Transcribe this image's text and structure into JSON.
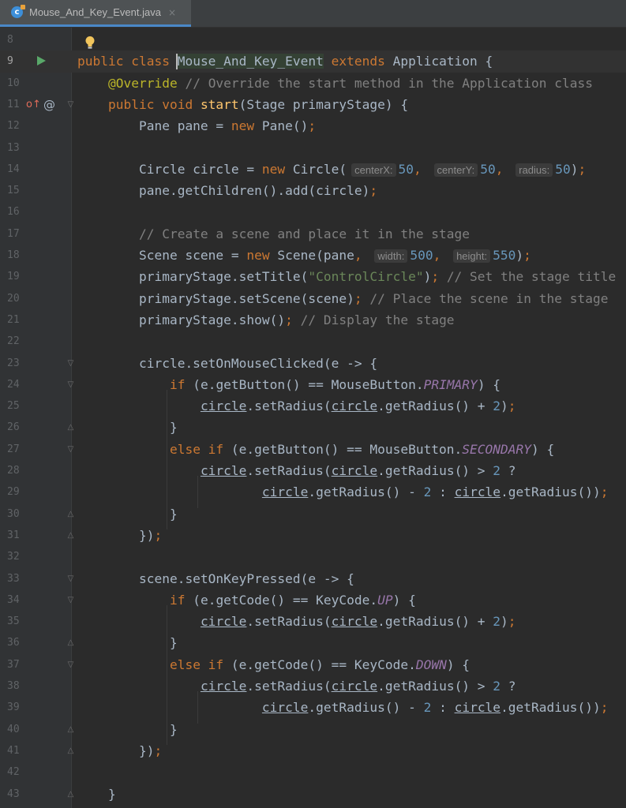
{
  "tab": {
    "icon": "java-class-icon",
    "icon_letter": "c",
    "title": "Mouse_And_Key_Event.java",
    "close": "×"
  },
  "lines": [
    {
      "n": "8",
      "code": []
    },
    {
      "n": "9",
      "code": [
        [
          "kw",
          "public class "
        ],
        [
          "",
          "Mouse_And_Key_Event "
        ],
        [
          "kw",
          "extends "
        ],
        [
          "",
          "Application {"
        ]
      ]
    },
    {
      "n": "10",
      "code": [
        [
          "",
          "    "
        ],
        [
          "an",
          "@Override "
        ],
        [
          "cm",
          "// Override the start method in the Application class"
        ]
      ]
    },
    {
      "n": "11",
      "code": [
        [
          "",
          "    "
        ],
        [
          "kw",
          "public void "
        ],
        [
          "fn",
          "start"
        ],
        [
          "",
          "(Stage primaryStage) {"
        ]
      ]
    },
    {
      "n": "12",
      "code": [
        [
          "",
          "        Pane pane = "
        ],
        [
          "kw",
          "new "
        ],
        [
          "",
          "Pane()"
        ],
        [
          "kw",
          ";"
        ]
      ]
    },
    {
      "n": "13",
      "code": []
    },
    {
      "n": "14",
      "code": [
        [
          "",
          "        Circle circle = "
        ],
        [
          "kw",
          "new "
        ],
        [
          "",
          "Circle("
        ],
        [
          "hint",
          "centerX:"
        ],
        [
          "nm",
          "50"
        ],
        [
          "kw",
          ", "
        ],
        [
          "hint",
          "centerY:"
        ],
        [
          "nm",
          "50"
        ],
        [
          "kw",
          ", "
        ],
        [
          "hint",
          "radius:"
        ],
        [
          "nm",
          "50"
        ],
        [
          "",
          ")"
        ],
        [
          "kw",
          ";"
        ]
      ]
    },
    {
      "n": "15",
      "code": [
        [
          "",
          "        pane.getChildren().add(circle)"
        ],
        [
          "kw",
          ";"
        ]
      ]
    },
    {
      "n": "16",
      "code": []
    },
    {
      "n": "17",
      "code": [
        [
          "",
          "        "
        ],
        [
          "cm",
          "// Create a scene and place it in the stage"
        ]
      ]
    },
    {
      "n": "18",
      "code": [
        [
          "",
          "        Scene scene = "
        ],
        [
          "kw",
          "new "
        ],
        [
          "",
          "Scene(pane"
        ],
        [
          "kw",
          ", "
        ],
        [
          "hint",
          "width:"
        ],
        [
          "nm",
          "500"
        ],
        [
          "kw",
          ", "
        ],
        [
          "hint",
          "height:"
        ],
        [
          "nm",
          "550"
        ],
        [
          "",
          ")"
        ],
        [
          "kw",
          ";"
        ]
      ]
    },
    {
      "n": "19",
      "code": [
        [
          "",
          "        primaryStage.setTitle("
        ],
        [
          "st",
          "\"ControlCircle\""
        ],
        [
          "",
          ")"
        ],
        [
          "kw",
          "; "
        ],
        [
          "cm",
          "// Set the stage title"
        ]
      ]
    },
    {
      "n": "20",
      "code": [
        [
          "",
          "        primaryStage.setScene(scene)"
        ],
        [
          "kw",
          "; "
        ],
        [
          "cm",
          "// Place the scene in the stage"
        ]
      ]
    },
    {
      "n": "21",
      "code": [
        [
          "",
          "        primaryStage.show()"
        ],
        [
          "kw",
          "; "
        ],
        [
          "cm",
          "// Display the stage"
        ]
      ]
    },
    {
      "n": "22",
      "code": []
    },
    {
      "n": "23",
      "code": [
        [
          "",
          "        circle.setOnMouseClicked(e -> {"
        ]
      ]
    },
    {
      "n": "24",
      "code": [
        [
          "",
          "            "
        ],
        [
          "kw",
          "if "
        ],
        [
          "",
          "(e.getButton() == MouseButton."
        ],
        [
          "fld",
          "PRIMARY"
        ],
        [
          "",
          ") {"
        ]
      ]
    },
    {
      "n": "25",
      "code": [
        [
          "",
          "                "
        ],
        [
          "ul",
          "circle"
        ],
        [
          "",
          ".setRadius("
        ],
        [
          "ul",
          "circle"
        ],
        [
          "",
          ".getRadius() + "
        ],
        [
          "nm",
          "2"
        ],
        [
          "",
          ")"
        ],
        [
          "kw",
          ";"
        ]
      ]
    },
    {
      "n": "26",
      "code": [
        [
          "",
          "            }"
        ]
      ]
    },
    {
      "n": "27",
      "code": [
        [
          "",
          "            "
        ],
        [
          "kw",
          "else if "
        ],
        [
          "",
          "(e.getButton() == MouseButton."
        ],
        [
          "fld",
          "SECONDARY"
        ],
        [
          "",
          ") {"
        ]
      ]
    },
    {
      "n": "28",
      "code": [
        [
          "",
          "                "
        ],
        [
          "ul",
          "circle"
        ],
        [
          "",
          ".setRadius("
        ],
        [
          "ul",
          "circle"
        ],
        [
          "",
          ".getRadius() > "
        ],
        [
          "nm",
          "2"
        ],
        [
          "",
          " ?"
        ]
      ]
    },
    {
      "n": "29",
      "code": [
        [
          "",
          "                        "
        ],
        [
          "ul",
          "circle"
        ],
        [
          "",
          ".getRadius() - "
        ],
        [
          "nm",
          "2"
        ],
        [
          "",
          " : "
        ],
        [
          "ul",
          "circle"
        ],
        [
          "",
          ".getRadius())"
        ],
        [
          "kw",
          ";"
        ]
      ]
    },
    {
      "n": "30",
      "code": [
        [
          "",
          "            }"
        ]
      ]
    },
    {
      "n": "31",
      "code": [
        [
          "",
          "        })"
        ],
        [
          "kw",
          ";"
        ]
      ]
    },
    {
      "n": "32",
      "code": []
    },
    {
      "n": "33",
      "code": [
        [
          "",
          "        scene.setOnKeyPressed(e -> {"
        ]
      ]
    },
    {
      "n": "34",
      "code": [
        [
          "",
          "            "
        ],
        [
          "kw",
          "if "
        ],
        [
          "",
          "(e.getCode() == KeyCode."
        ],
        [
          "fld",
          "UP"
        ],
        [
          "",
          ") {"
        ]
      ]
    },
    {
      "n": "35",
      "code": [
        [
          "",
          "                "
        ],
        [
          "ul",
          "circle"
        ],
        [
          "",
          ".setRadius("
        ],
        [
          "ul",
          "circle"
        ],
        [
          "",
          ".getRadius() + "
        ],
        [
          "nm",
          "2"
        ],
        [
          "",
          ")"
        ],
        [
          "kw",
          ";"
        ]
      ]
    },
    {
      "n": "36",
      "code": [
        [
          "",
          "            }"
        ]
      ]
    },
    {
      "n": "37",
      "code": [
        [
          "",
          "            "
        ],
        [
          "kw",
          "else if "
        ],
        [
          "",
          "(e.getCode() == KeyCode."
        ],
        [
          "fld",
          "DOWN"
        ],
        [
          "",
          ") {"
        ]
      ]
    },
    {
      "n": "38",
      "code": [
        [
          "",
          "                "
        ],
        [
          "ul",
          "circle"
        ],
        [
          "",
          ".setRadius("
        ],
        [
          "ul",
          "circle"
        ],
        [
          "",
          ".getRadius() > "
        ],
        [
          "nm",
          "2"
        ],
        [
          "",
          " ?"
        ]
      ]
    },
    {
      "n": "39",
      "code": [
        [
          "",
          "                        "
        ],
        [
          "ul",
          "circle"
        ],
        [
          "",
          ".getRadius() - "
        ],
        [
          "nm",
          "2"
        ],
        [
          "",
          " : "
        ],
        [
          "ul",
          "circle"
        ],
        [
          "",
          ".getRadius())"
        ],
        [
          "kw",
          ";"
        ]
      ]
    },
    {
      "n": "40",
      "code": [
        [
          "",
          "            }"
        ]
      ]
    },
    {
      "n": "41",
      "code": [
        [
          "",
          "        })"
        ],
        [
          "kw",
          ";"
        ]
      ]
    },
    {
      "n": "42",
      "code": []
    },
    {
      "n": "43",
      "code": [
        [
          "",
          "    }"
        ]
      ]
    }
  ],
  "active_line": "9",
  "gutter_icons": {
    "run": "run-icon",
    "override": "override-icon",
    "override_glyph": "o↑",
    "annotation": "annotation-icon",
    "annotation_glyph": "@",
    "intention": "lightbulb-icon",
    "fold": "fold-icon"
  },
  "colors": {
    "background": "#2b2b2b",
    "gutter": "#313335",
    "keyword": "#cc7832",
    "annotation": "#bbb529",
    "comment": "#808080",
    "string": "#6a8759",
    "number": "#6897bb",
    "method": "#ffc66d",
    "field": "#9876aa",
    "text": "#a9b7c6"
  }
}
